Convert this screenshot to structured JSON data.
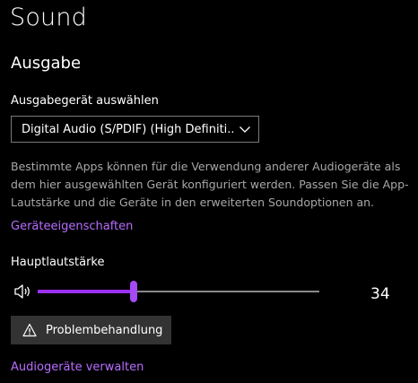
{
  "page": {
    "title": "Sound"
  },
  "output": {
    "section_title": "Ausgabe",
    "device_label": "Ausgabegerät auswählen",
    "device_selected": "Digital Audio (S/PDIF) (High Definiti...",
    "chevron_icon": "chevron-down-icon",
    "description": "Bestimmte Apps können für die Verwendung anderer Audiogeräte als dem hier ausgewählten Gerät konfiguriert werden. Passen Sie die App-Lautstärke und die Geräte in den erweiterten Soundoptionen an.",
    "properties_link": "Geräteeigenschaften",
    "master_volume_label": "Hauptlautstärke",
    "speaker_icon": "speaker-icon",
    "volume_level_percent": 34,
    "volume_value": "34",
    "troubleshoot_icon": "warning-icon",
    "troubleshoot_label": "Problembehandlung",
    "manage_devices_link": "Audiogeräte verwalten"
  },
  "colors": {
    "background": "#000000",
    "accent_link": "#b86dff",
    "slider_fill": "#9b30f0",
    "slider_thumb": "#a54af5",
    "slider_track": "#8a8a8a",
    "button_bg": "#333333",
    "description_text": "#a8a8a8"
  }
}
